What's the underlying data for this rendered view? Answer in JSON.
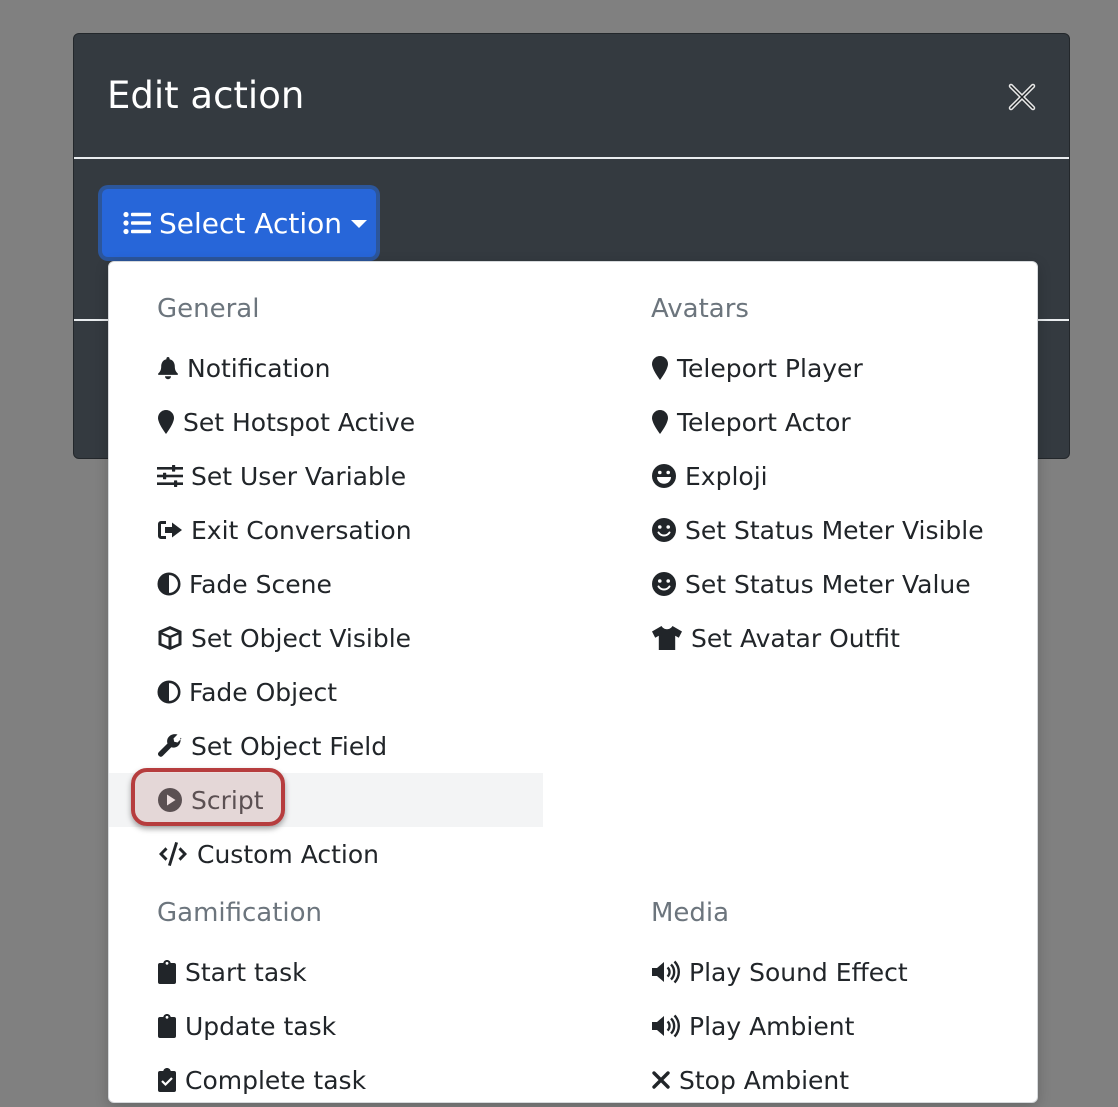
{
  "modal": {
    "title": "Edit action",
    "close_icon": "close-icon"
  },
  "select_button": {
    "label": "Select Action",
    "icon": "list-icon"
  },
  "dropdown": {
    "general": {
      "header": "General",
      "items": [
        {
          "label": "Notification",
          "icon": "bell-icon"
        },
        {
          "label": "Set Hotspot Active",
          "icon": "map-marker-icon"
        },
        {
          "label": "Set User Variable",
          "icon": "sliders-icon"
        },
        {
          "label": "Exit Conversation",
          "icon": "exit-icon"
        },
        {
          "label": "Fade Scene",
          "icon": "adjust-icon"
        },
        {
          "label": "Set Object Visible",
          "icon": "cube-icon"
        },
        {
          "label": "Fade Object",
          "icon": "adjust-icon"
        },
        {
          "label": "Set Object Field",
          "icon": "wrench-icon"
        },
        {
          "label": "Script",
          "icon": "play-circle-icon"
        },
        {
          "label": "Custom Action",
          "icon": "code-icon"
        }
      ]
    },
    "gamification": {
      "header": "Gamification",
      "items": [
        {
          "label": "Start task",
          "icon": "clipboard-icon"
        },
        {
          "label": "Update task",
          "icon": "clipboard-icon"
        },
        {
          "label": "Complete task",
          "icon": "clipboard-check-icon"
        }
      ]
    },
    "avatars": {
      "header": "Avatars",
      "items": [
        {
          "label": "Teleport Player",
          "icon": "map-marker-icon"
        },
        {
          "label": "Teleport Actor",
          "icon": "map-marker-icon"
        },
        {
          "label": "Exploji",
          "icon": "grin-icon"
        },
        {
          "label": "Set Status Meter Visible",
          "icon": "smile-icon"
        },
        {
          "label": "Set Status Meter Value",
          "icon": "smile-icon"
        },
        {
          "label": "Set Avatar Outfit",
          "icon": "tshirt-icon"
        }
      ]
    },
    "media": {
      "header": "Media",
      "items": [
        {
          "label": "Play Sound Effect",
          "icon": "volume-icon"
        },
        {
          "label": "Play Ambient",
          "icon": "volume-icon"
        },
        {
          "label": "Stop Ambient",
          "icon": "times-icon"
        }
      ]
    },
    "active_item": "Script"
  },
  "colors": {
    "backdrop": "#808080",
    "modal_bg": "#343a40",
    "primary": "#2766d9",
    "highlight_border": "#b63d3e",
    "success": "#28a745"
  }
}
